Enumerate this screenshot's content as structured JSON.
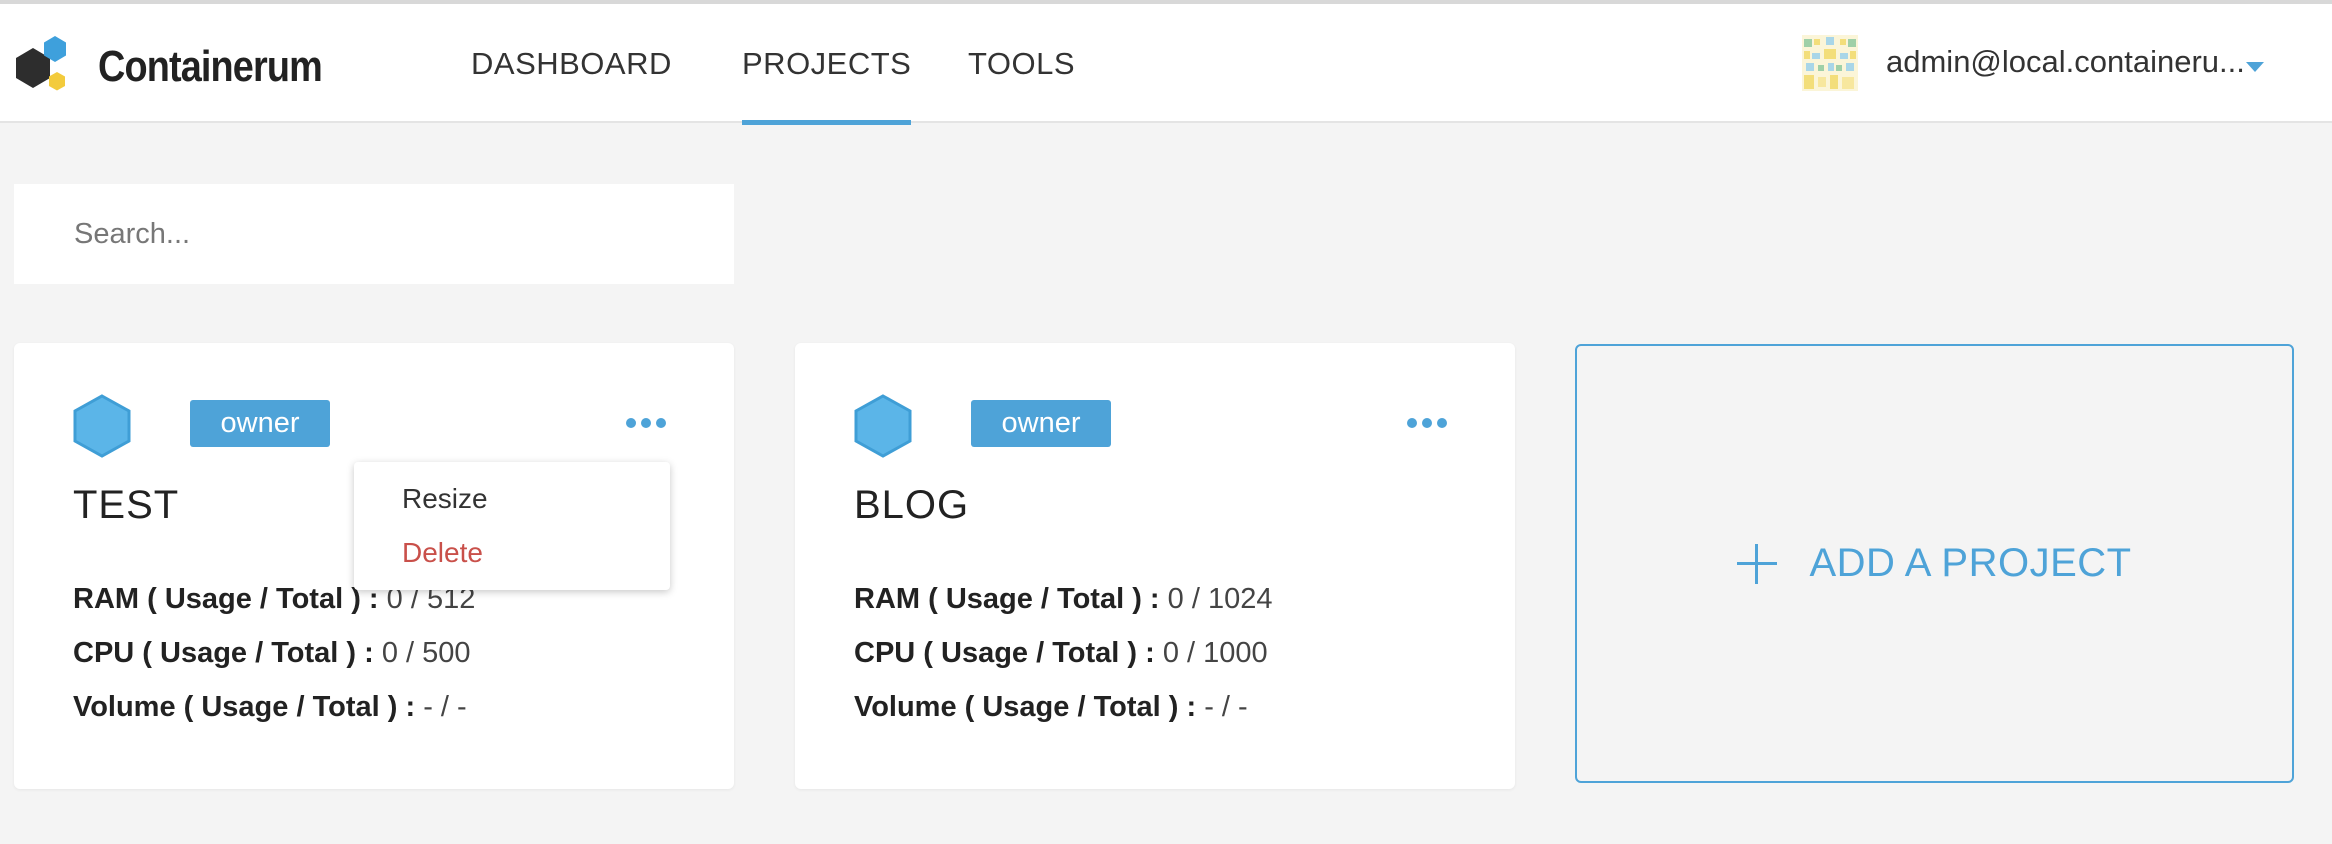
{
  "app": {
    "name": "Containerum",
    "logo_colors": {
      "dark": "#2d2d2d",
      "blue": "#3ea0dc",
      "yellow": "#f3cb3c"
    }
  },
  "nav": {
    "items": [
      {
        "label": "DASHBOARD",
        "active": false
      },
      {
        "label": "PROJECTS",
        "active": true
      },
      {
        "label": "TOOLS",
        "active": false
      }
    ],
    "accent": "#4ea3d8"
  },
  "user": {
    "email": "admin@local.containeru...",
    "avatar_icon": "identicon-avatar"
  },
  "search": {
    "placeholder": "Search...",
    "value": ""
  },
  "projects": [
    {
      "name": "TEST",
      "role": "owner",
      "ram_label": "RAM ( Usage / Total ) :",
      "ram_value": "0 / 512",
      "cpu_label": "CPU ( Usage / Total ) :",
      "cpu_value": "0 / 500",
      "volume_label": "Volume ( Usage / Total ) :",
      "volume_value": "- / -",
      "menu_open": true
    },
    {
      "name": "BLOG",
      "role": "owner",
      "ram_label": "RAM ( Usage / Total ) :",
      "ram_value": "0 / 1024",
      "cpu_label": "CPU ( Usage / Total ) :",
      "cpu_value": "0 / 1000",
      "volume_label": "Volume ( Usage / Total ) :",
      "volume_value": "- / -",
      "menu_open": false
    }
  ],
  "project_menu": {
    "items": [
      {
        "label": "Resize",
        "color": "#333333"
      },
      {
        "label": "Delete",
        "color": "#c9504a"
      }
    ]
  },
  "add_project": {
    "label": "ADD A PROJECT",
    "icon": "plus-icon"
  }
}
